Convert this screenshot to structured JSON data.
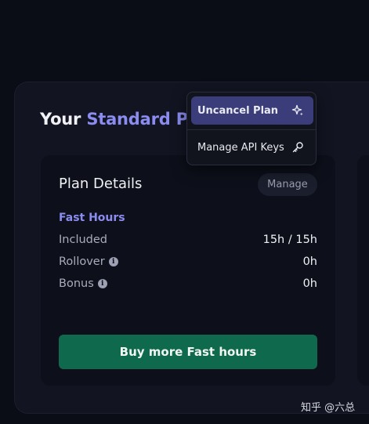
{
  "header": {
    "title_prefix": "Your ",
    "title_plan": "Standard Pl"
  },
  "plan_card": {
    "title": "Plan Details",
    "manage_label": "Manage",
    "section_label": "Fast Hours",
    "rows": [
      {
        "label": "Included",
        "value": "15h / 15h"
      },
      {
        "label": "Rollover",
        "value": "0h"
      },
      {
        "label": "Bonus",
        "value": "0h"
      }
    ],
    "buy_label": "Buy more Fast hours"
  },
  "dropdown": {
    "items": [
      {
        "label": "Uncancel Plan",
        "icon": "sparkle-icon"
      },
      {
        "label": "Manage API Keys",
        "icon": "key-icon"
      }
    ]
  },
  "watermark": "知乎 @六总",
  "colors": {
    "accent": "#8b8cf0",
    "button_green": "#0f6a4d",
    "menu_active": "#3a3d7a"
  }
}
